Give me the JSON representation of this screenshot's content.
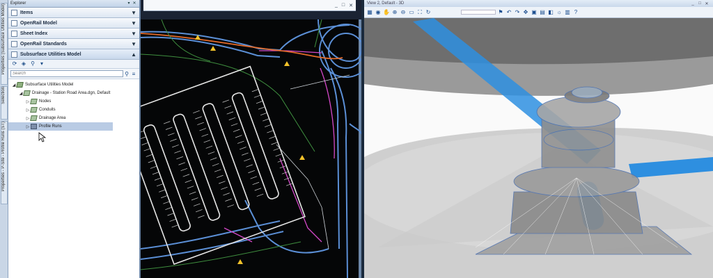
{
  "vertical_tabs": [
    {
      "label": "Properties (Subsurface Utilities Model)"
    },
    {
      "label": "Selection"
    },
    {
      "label": "Properties - P-Site - Profile Runs (ST)"
    }
  ],
  "explorer": {
    "title": "Explorer",
    "sections": [
      {
        "label": "Items"
      },
      {
        "label": "OpenRail Model"
      },
      {
        "label": "Sheet Index"
      },
      {
        "label": "OpenRail Standards"
      },
      {
        "label": "Subsurface Utilities Model"
      }
    ],
    "search_placeholder": "Search",
    "tree": [
      {
        "label": "Subsurface Utilities Model",
        "twist": "◢",
        "depth": 0
      },
      {
        "label": "Drainage - Station Road Area.dgn, Default",
        "twist": "◢",
        "depth": 1
      },
      {
        "label": "Nodes",
        "twist": "▷",
        "depth": 2
      },
      {
        "label": "Conduits",
        "twist": "▷",
        "depth": 2
      },
      {
        "label": "Drainage Area",
        "twist": "▷",
        "depth": 2
      },
      {
        "label": "Profile Runs",
        "twist": "▷",
        "depth": 2,
        "selected": true
      }
    ]
  },
  "plan_view": {
    "window_buttons": [
      "_",
      "□",
      "✕"
    ]
  },
  "view3d": {
    "title": "View 2, Default - 3D",
    "window_buttons": [
      "_",
      "□",
      "✕"
    ]
  },
  "colors": {
    "road_blue": "#5b8fd6",
    "pipe_blue": "#2e8fe0",
    "pink_line": "#d448c8",
    "orange_line": "#e56b2a",
    "green_line": "#3f8f3f",
    "warning": "#f2c22a"
  }
}
